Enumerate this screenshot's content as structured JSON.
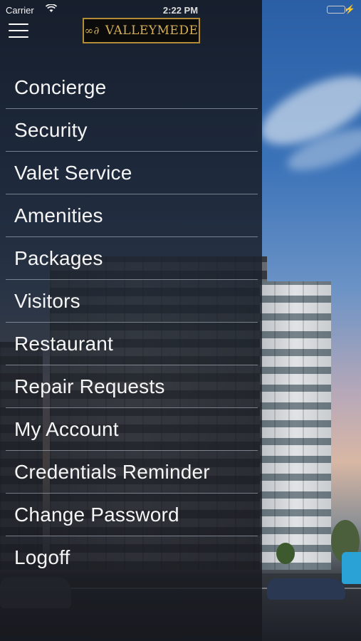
{
  "status_bar": {
    "carrier": "Carrier",
    "time": "2:22 PM",
    "wifi_icon": "wifi-icon",
    "battery_icon": "battery-icon",
    "battery_level": 1.0,
    "battery_color": "#4cd964"
  },
  "header": {
    "menu_icon": "hamburger-icon",
    "logo_text": "VALLEYMEDE",
    "logo_mark": "∞∂"
  },
  "menu": {
    "items": [
      {
        "label": "Concierge"
      },
      {
        "label": "Security"
      },
      {
        "label": "Valet Service"
      },
      {
        "label": "Amenities"
      },
      {
        "label": "Packages"
      },
      {
        "label": "Visitors"
      },
      {
        "label": "Restaurant"
      },
      {
        "label": "Repair Requests"
      },
      {
        "label": "My Account"
      },
      {
        "label": "Credentials Reminder"
      },
      {
        "label": "Change Password"
      },
      {
        "label": "Logoff"
      }
    ]
  },
  "colors": {
    "logo_gold": "#d4af5a",
    "drawer_bg": "#1c2432"
  }
}
